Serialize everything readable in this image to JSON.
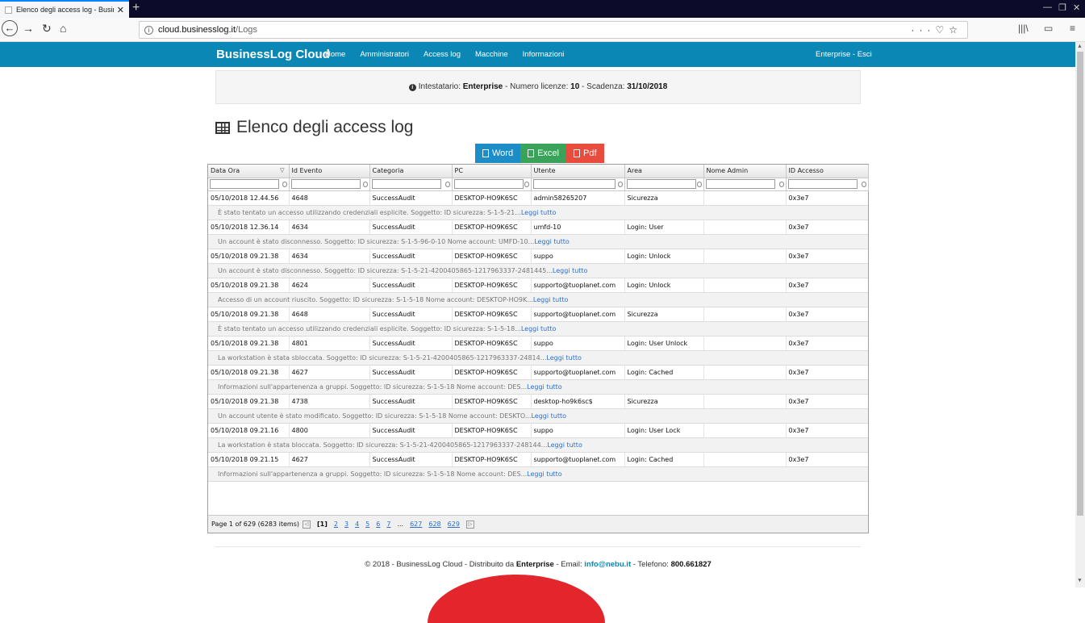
{
  "browser": {
    "tab_title": "Elenco degli access log - BusinessLog Cloud",
    "url_host": "cloud.businesslog.it",
    "url_path": "/Logs"
  },
  "site": {
    "brand": "BusinessLog Cloud",
    "menu": [
      "Home",
      "Amministratori",
      "Access log",
      "Macchine",
      "Informazioni"
    ],
    "user_link": "Enterprise - Esci"
  },
  "info": {
    "label_holder": "Intestatario: ",
    "holder": "Enterprise",
    "label_licenses": " - Numero licenze: ",
    "licenses": "10",
    "label_expiry": " - Scadenza: ",
    "expiry": "31/10/2018"
  },
  "page_title": "Elenco degli access log",
  "exports": {
    "word": "Word",
    "excel": "Excel",
    "pdf": "Pdf"
  },
  "columns": [
    "Data Ora",
    "Id Evento",
    "Categoria",
    "PC",
    "Utente",
    "Area",
    "Nome Admin",
    "ID Accesso"
  ],
  "rows": [
    {
      "date": "05/10/2018 12.44.56",
      "event": "4648",
      "cat": "SuccessAudit",
      "pc": "DESKTOP-HO9K6SC",
      "user": "admin58265207",
      "area": "Sicurezza",
      "admin": "",
      "access": "0x3e7",
      "preview": "È stato tentato un accesso utilizzando credenziali esplicite. Soggetto: ID sicurezza: S-1-5-21..."
    },
    {
      "date": "05/10/2018 12.36.14",
      "event": "4634",
      "cat": "SuccessAudit",
      "pc": "DESKTOP-HO9K6SC",
      "user": "umfd-10",
      "area": "Login: User",
      "admin": "",
      "access": "0x3e7",
      "preview": "Un account è stato disconnesso. Soggetto: ID sicurezza: S-1-5-96-0-10 Nome account: UMFD-10..."
    },
    {
      "date": "05/10/2018 09.21.38",
      "event": "4634",
      "cat": "SuccessAudit",
      "pc": "DESKTOP-HO9K6SC",
      "user": "suppo",
      "area": "Login: Unlock",
      "admin": "",
      "access": "0x3e7",
      "preview": "Un account è stato disconnesso. Soggetto: ID sicurezza: S-1-5-21-4200405865-1217963337-2481445..."
    },
    {
      "date": "05/10/2018 09.21.38",
      "event": "4624",
      "cat": "SuccessAudit",
      "pc": "DESKTOP-HO9K6SC",
      "user": "supporto@tuoplanet.com",
      "area": "Login: Unlock",
      "admin": "",
      "access": "0x3e7",
      "preview": "Accesso di un account riuscito. Soggetto: ID sicurezza: S-1-5-18 Nome account: DESKTOP-HO9K..."
    },
    {
      "date": "05/10/2018 09.21.38",
      "event": "4648",
      "cat": "SuccessAudit",
      "pc": "DESKTOP-HO9K6SC",
      "user": "supporto@tuoplanet.com",
      "area": "Sicurezza",
      "admin": "",
      "access": "0x3e7",
      "preview": "È stato tentato un accesso utilizzando credenziali esplicite. Soggetto: ID sicurezza: S-1-5-18..."
    },
    {
      "date": "05/10/2018 09.21.38",
      "event": "4801",
      "cat": "SuccessAudit",
      "pc": "DESKTOP-HO9K6SC",
      "user": "suppo",
      "area": "Login: User Unlock",
      "admin": "",
      "access": "0x3e7",
      "preview": "La workstation è stata sbloccata. Soggetto: ID sicurezza: S-1-5-21-4200405865-1217963337-24814..."
    },
    {
      "date": "05/10/2018 09.21.38",
      "event": "4627",
      "cat": "SuccessAudit",
      "pc": "DESKTOP-HO9K6SC",
      "user": "supporto@tuoplanet.com",
      "area": "Login: Cached",
      "admin": "",
      "access": "0x3e7",
      "preview": "Informazioni sull'appartenenza a gruppi. Soggetto: ID sicurezza: S-1-5-18 Nome account: DES..."
    },
    {
      "date": "05/10/2018 09.21.38",
      "event": "4738",
      "cat": "SuccessAudit",
      "pc": "DESKTOP-HO9K6SC",
      "user": "desktop-ho9k6sc$",
      "area": "Sicurezza",
      "admin": "",
      "access": "0x3e7",
      "preview": "Un account utente è stato modificato. Soggetto: ID sicurezza: S-1-5-18 Nome account: DESKTO..."
    },
    {
      "date": "05/10/2018 09.21.16",
      "event": "4800",
      "cat": "SuccessAudit",
      "pc": "DESKTOP-HO9K6SC",
      "user": "suppo",
      "area": "Login: User Lock",
      "admin": "",
      "access": "0x3e7",
      "preview": "La workstation è stata bloccata. Soggetto: ID sicurezza: S-1-5-21-4200405865-1217963337-248144..."
    },
    {
      "date": "05/10/2018 09.21.15",
      "event": "4627",
      "cat": "SuccessAudit",
      "pc": "DESKTOP-HO9K6SC",
      "user": "supporto@tuoplanet.com",
      "area": "Login: Cached",
      "admin": "",
      "access": "0x3e7",
      "preview": "Informazioni sull'appartenenza a gruppi. Soggetto: ID sicurezza: S-1-5-18 Nome account: DES..."
    }
  ],
  "read_more": "Leggi tutto",
  "pager": {
    "summary": "Page 1 of 629 (6283 items)",
    "current": "[1]",
    "pages": [
      "2",
      "3",
      "4",
      "5",
      "6",
      "7"
    ],
    "ellipsis": "...",
    "last_pages": [
      "627",
      "628",
      "629"
    ]
  },
  "footer": {
    "prefix": "© 2018 - BusinessLog Cloud - Distribuito da ",
    "company": "Enterprise",
    "email_label": " - Email: ",
    "email": "info@nebu.it",
    "phone_label": " - Telefono: ",
    "phone": "800.661827"
  },
  "colors": {
    "header_blue": "#0a87b5",
    "word": "#1d8dc7",
    "excel": "#3aa35a",
    "pdf": "#e74c3c",
    "link": "#2c6fd1"
  }
}
